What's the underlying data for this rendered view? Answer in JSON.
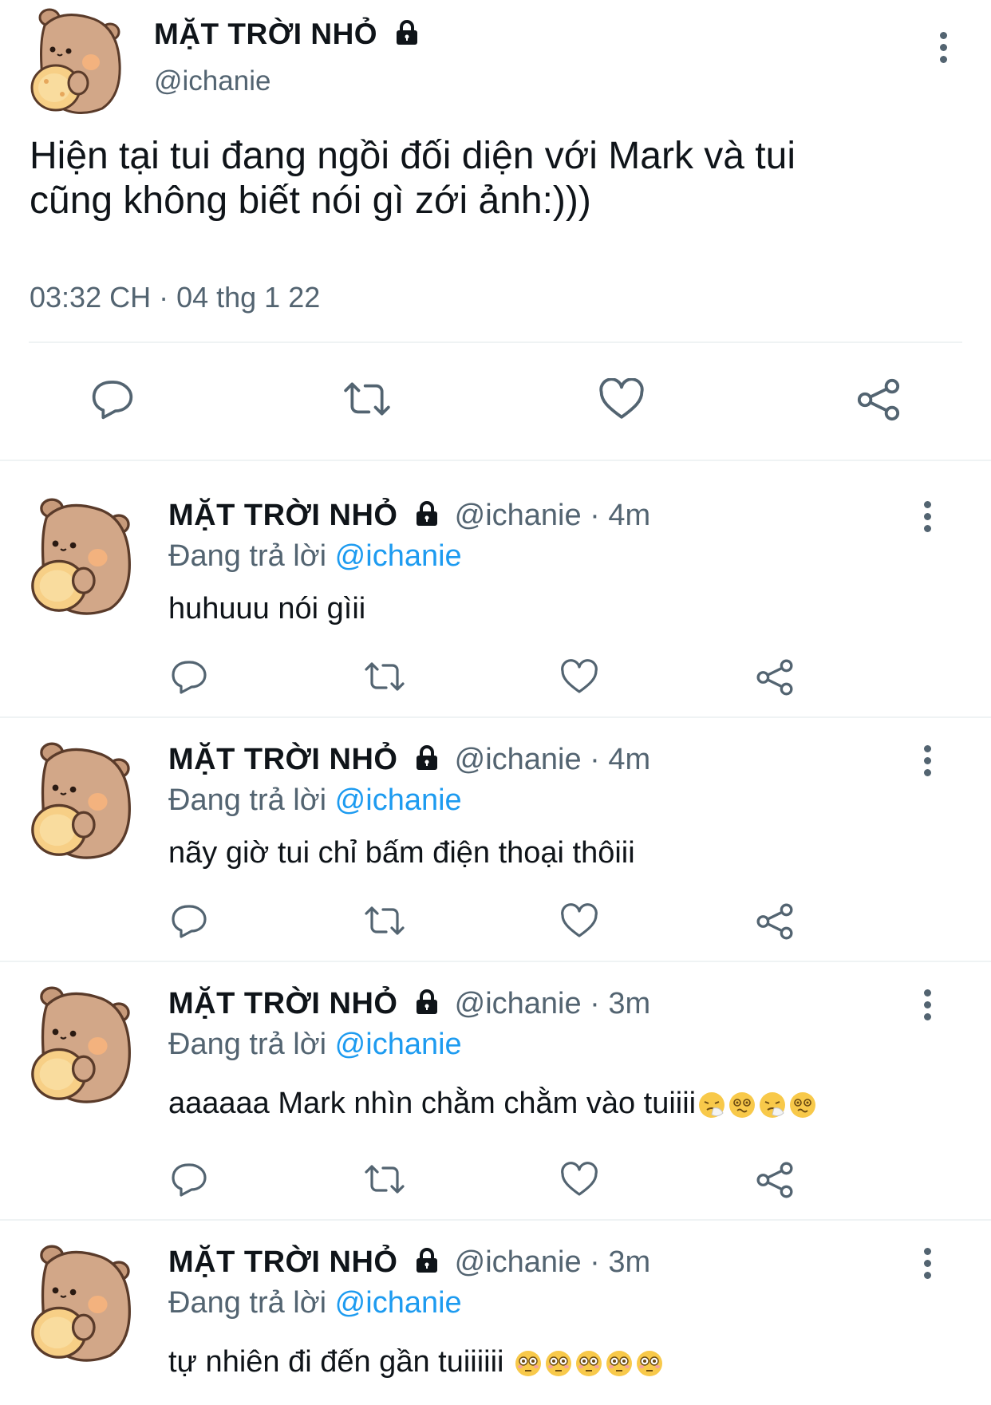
{
  "main_tweet": {
    "display_name": "MẶT TRỜI NHỎ",
    "handle": "@ichanie",
    "text_line1": "Hiện tại tui đang ngồi đối diện với Mark và tui",
    "text_line2": "cũng không biết nói gì zới ảnh:)))",
    "timestamp": "03:32 CH · 04 thg 1 22"
  },
  "replies": [
    {
      "display_name": "MẶT TRỜI NHỎ",
      "handle_time": "@ichanie · 4m",
      "replying_prefix": "Đang trả lời",
      "replying_to": "@ichanie",
      "text": "huhuuu nói gìii"
    },
    {
      "display_name": "MẶT TRỜI NHỎ",
      "handle_time": "@ichanie · 4m",
      "replying_prefix": "Đang trả lời",
      "replying_to": "@ichanie",
      "text": "nãy giờ tui chỉ bấm điện thoại thôiii"
    },
    {
      "display_name": "MẶT TRỜI NHỎ",
      "handle_time": "@ichanie · 3m",
      "replying_prefix": "Đang trả lời",
      "replying_to": "@ichanie",
      "text": "aaaaaa Mark nhìn chằm chằm vào tuiiii"
    },
    {
      "display_name": "MẶT TRỜI NHỎ",
      "handle_time": "@ichanie · 3m",
      "replying_prefix": "Đang trả lời",
      "replying_to": "@ichanie",
      "text": "tự nhiên đi đến gần tuiiiiii "
    }
  ],
  "colors": {
    "text": "#0f1419",
    "muted": "#536471",
    "link": "#1d9bf0",
    "divider": "#eff3f4"
  },
  "icons": [
    "lock-icon",
    "more-icon",
    "reply-icon",
    "retweet-icon",
    "like-icon",
    "share-icon",
    "avatar-bear",
    "sneezing-emoji",
    "dizzy-emoji",
    "flushed-emoji"
  ]
}
